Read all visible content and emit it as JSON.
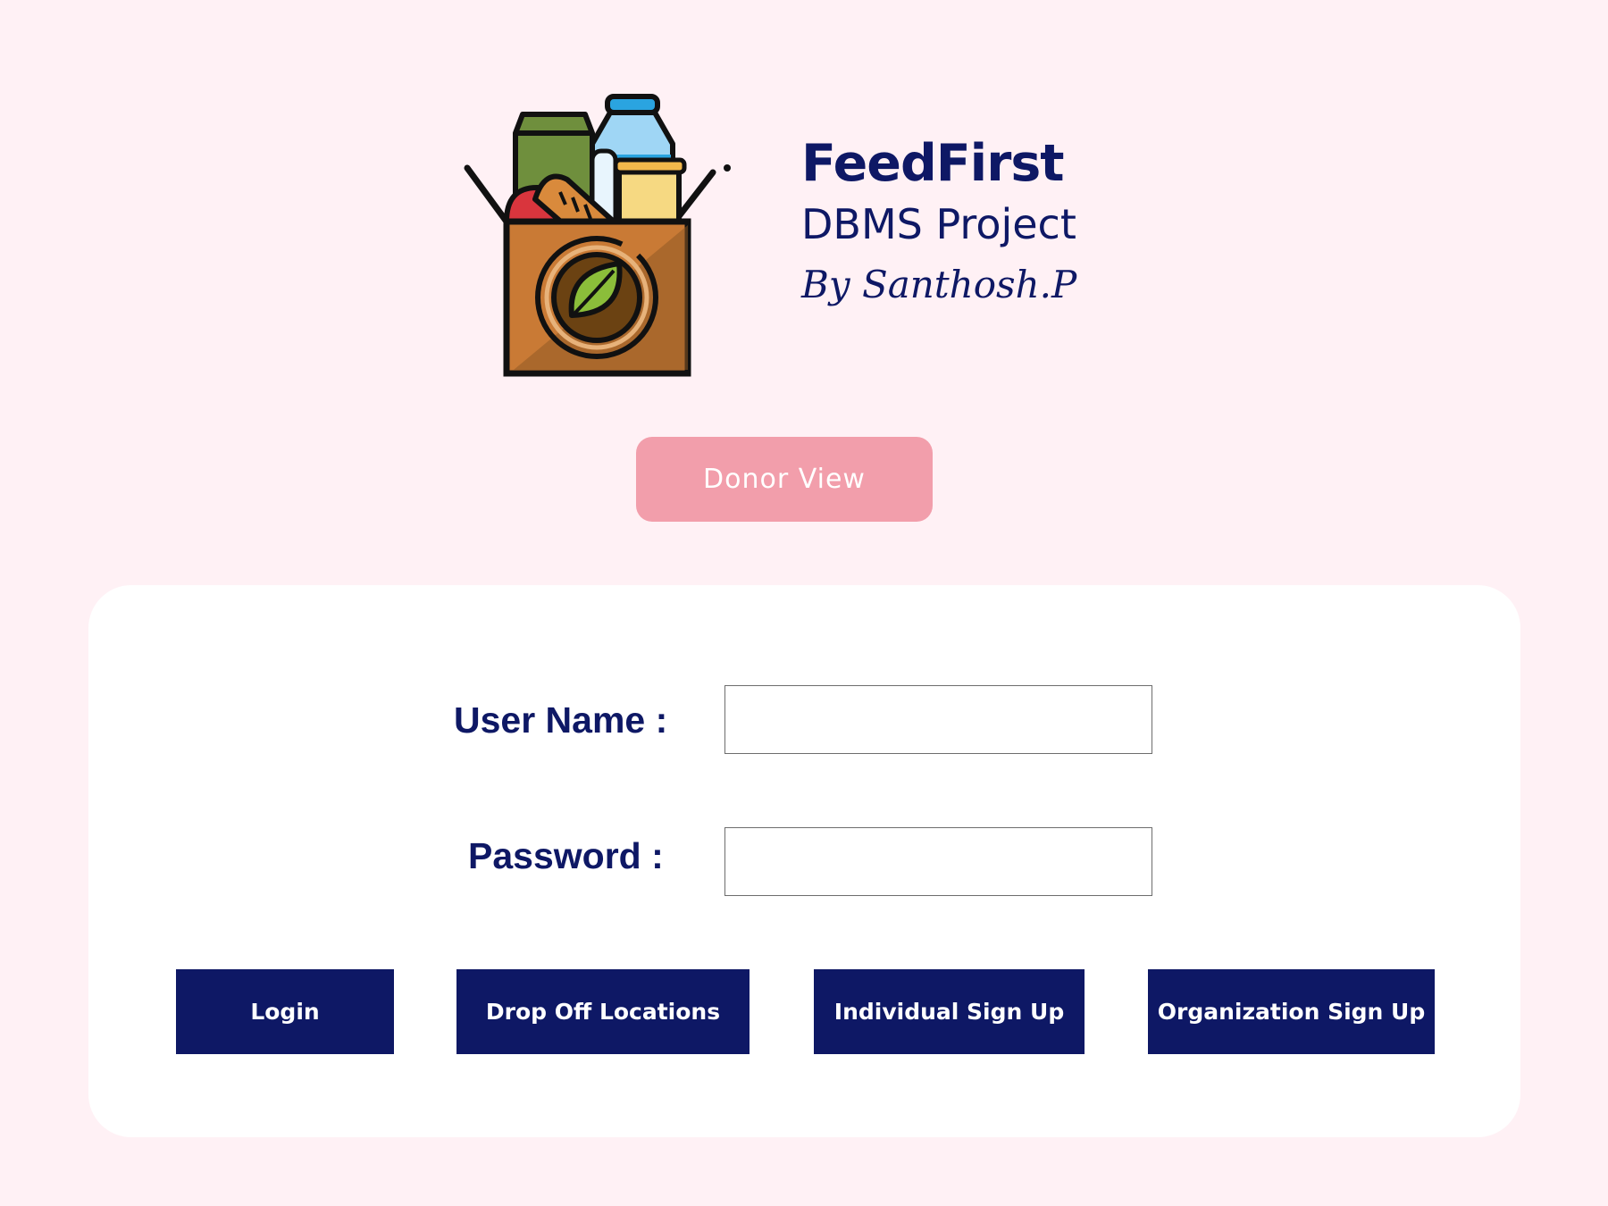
{
  "header": {
    "logo_icon": "grocery-donation-box-icon",
    "title": "FeedFirst",
    "subtitle": "DBMS Project",
    "author": "By Santhosh.P"
  },
  "donor_view_label": "Donor View",
  "login_form": {
    "username_label": "User Name :",
    "username_value": "",
    "password_label": "Password :",
    "password_value": ""
  },
  "actions": {
    "login": "Login",
    "drop_off": "Drop Off Locations",
    "individual_signup": "Individual Sign Up",
    "organization_signup": "Organization Sign Up"
  },
  "colors": {
    "background": "#fff1f5",
    "navy": "#0e1865",
    "donor_button": "#f29eab",
    "card": "#ffffff"
  }
}
